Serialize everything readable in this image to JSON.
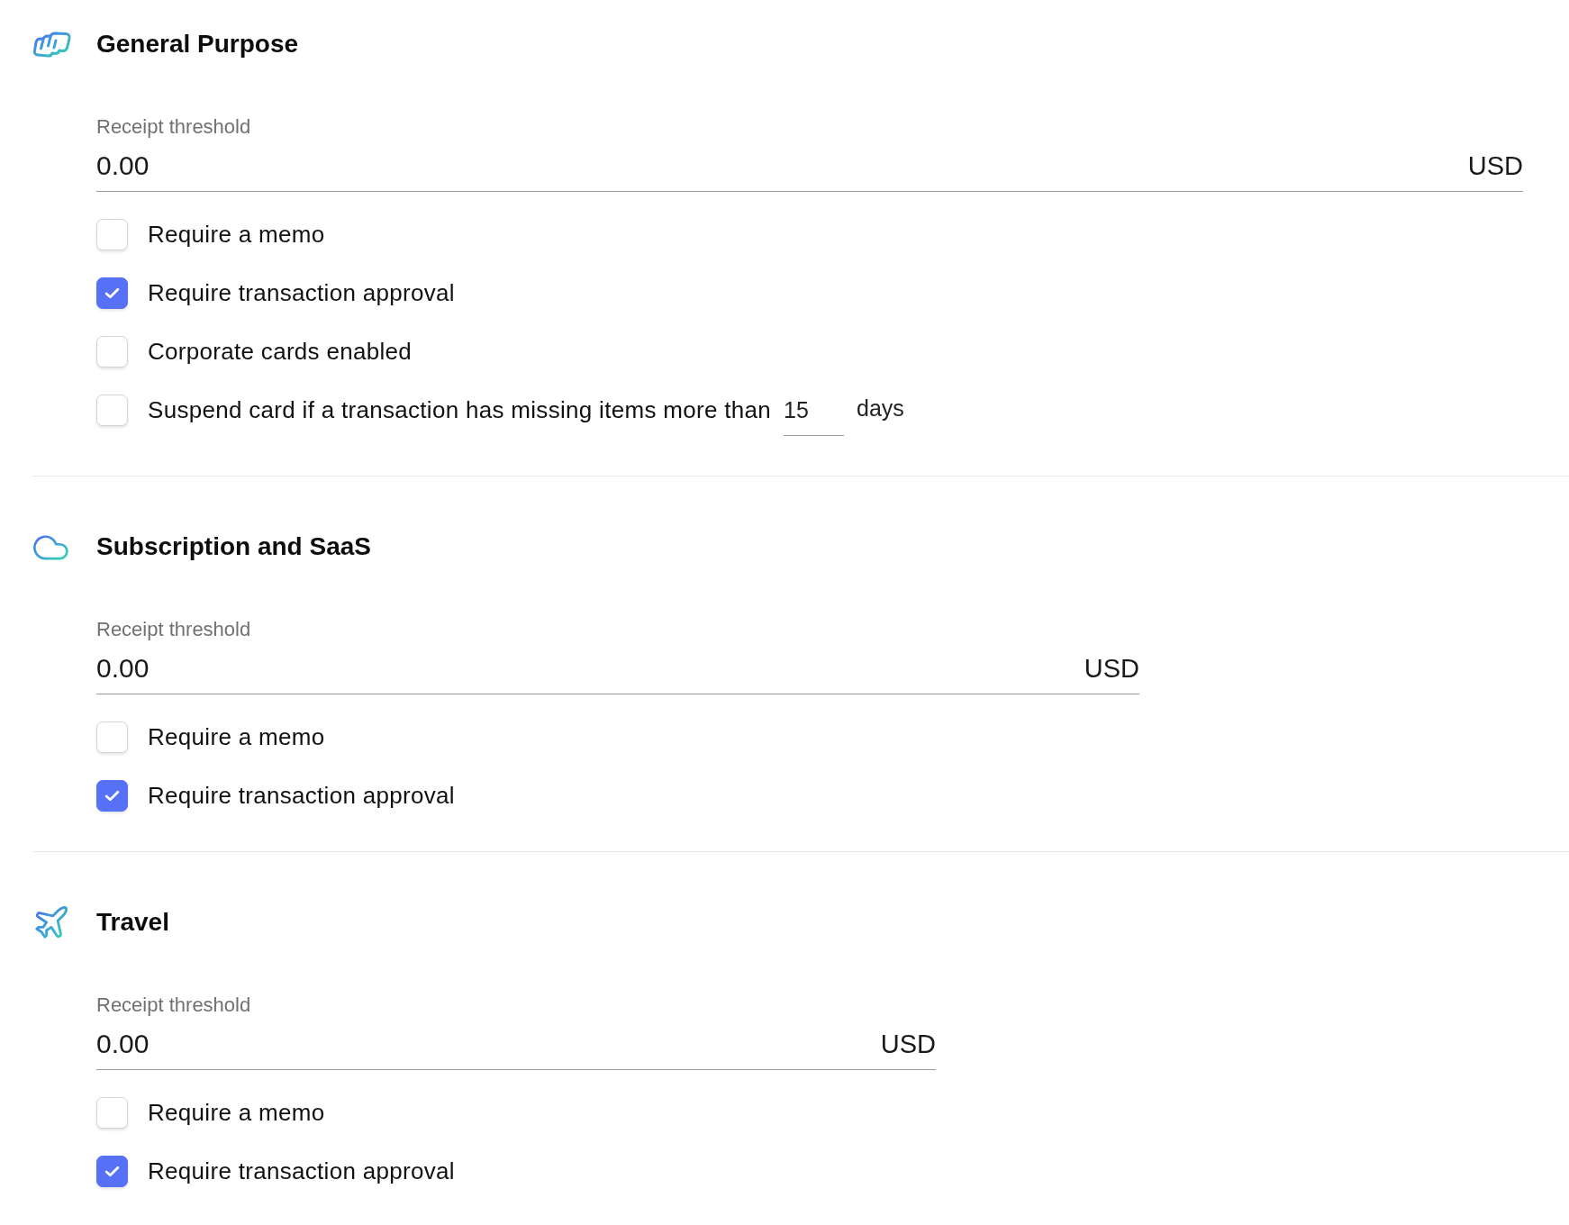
{
  "sections": [
    {
      "kind": "general",
      "title": "General Purpose",
      "threshold": {
        "label": "Receipt threshold",
        "value": "0.00",
        "currency": "USD"
      },
      "options": [
        {
          "kind": "checkbox",
          "label": "Require a memo",
          "checked": false
        },
        {
          "kind": "checkbox",
          "label": "Require transaction approval",
          "checked": true
        },
        {
          "kind": "checkbox",
          "label": "Corporate cards enabled",
          "checked": false
        },
        {
          "kind": "days",
          "label": "Suspend card if a transaction has missing items more than",
          "checked": false,
          "days": "15",
          "unit": "days"
        }
      ]
    },
    {
      "kind": "subscription",
      "title": "Subscription and SaaS",
      "threshold": {
        "label": "Receipt threshold",
        "value": "0.00",
        "currency": "USD"
      },
      "options": [
        {
          "kind": "checkbox",
          "label": "Require a memo",
          "checked": false
        },
        {
          "kind": "checkbox",
          "label": "Require transaction approval",
          "checked": true
        }
      ]
    },
    {
      "kind": "travel",
      "title": "Travel",
      "threshold": {
        "label": "Receipt threshold",
        "value": "0.00",
        "currency": "USD"
      },
      "options": [
        {
          "kind": "checkbox",
          "label": "Require a memo",
          "checked": false
        },
        {
          "kind": "checkbox",
          "label": "Require transaction approval",
          "checked": true
        }
      ]
    }
  ]
}
